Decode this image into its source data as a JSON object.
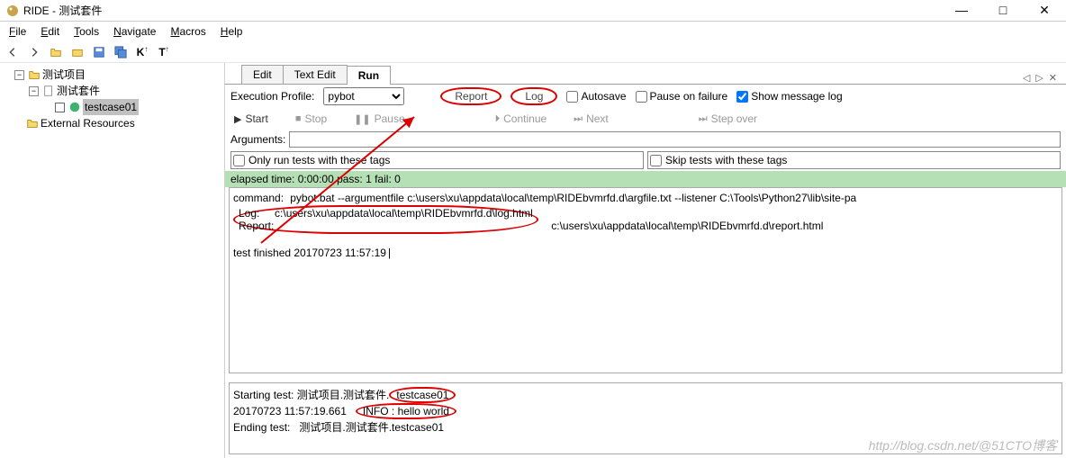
{
  "window": {
    "title": "RIDE - 测试套件"
  },
  "menu": {
    "file": "File",
    "edit": "Edit",
    "tools": "Tools",
    "navigate": "Navigate",
    "macros": "Macros",
    "help": "Help"
  },
  "tree": {
    "root": "测试项目",
    "suite": "测试套件",
    "case": "testcase01",
    "external": "External Resources"
  },
  "tabs": {
    "edit": "Edit",
    "textedit": "Text Edit",
    "run": "Run"
  },
  "run": {
    "profile_label": "Execution Profile:",
    "profile_value": "pybot",
    "report": "Report",
    "log": "Log",
    "autosave": "Autosave",
    "pause_on_failure": "Pause on failure",
    "show_message_log": "Show message log",
    "start": "Start",
    "stop": "Stop",
    "pause": "Pause",
    "continue": "Continue",
    "next": "Next",
    "stepover": "Step over",
    "arguments_label": "Arguments:",
    "arguments_value": "",
    "only_tags": "Only run tests with these tags",
    "skip_tags": "Skip tests with these tags"
  },
  "status": "elapsed time: 0:00:00     pass: 1     fail: 0",
  "output": {
    "command_label": "command:",
    "command": "pybot.bat --argumentfile c:\\users\\xu\\appdata\\local\\temp\\RIDEbvmrfd.d\\argfile.txt --listener C:\\Tools\\Python27\\lib\\site-pa",
    "log_label": "Log:",
    "log": "c:\\users\\xu\\appdata\\local\\temp\\RIDEbvmrfd.d\\log.html",
    "report_label": "Report:",
    "report": "c:\\users\\xu\\appdata\\local\\temp\\RIDEbvmrfd.d\\report.html",
    "finished": "test finished 20170723 11:57:19"
  },
  "msglog": {
    "line1a": "Starting test: 测试项目.测试套件.",
    "line1b": "testcase01",
    "line2a": "20170723 11:57:19.661   ",
    "line2b": "INFO : hello world",
    "line3": "Ending test:   测试项目.测试套件.testcase01"
  },
  "watermark": "http://blog.csdn.net/@51CTO博客"
}
